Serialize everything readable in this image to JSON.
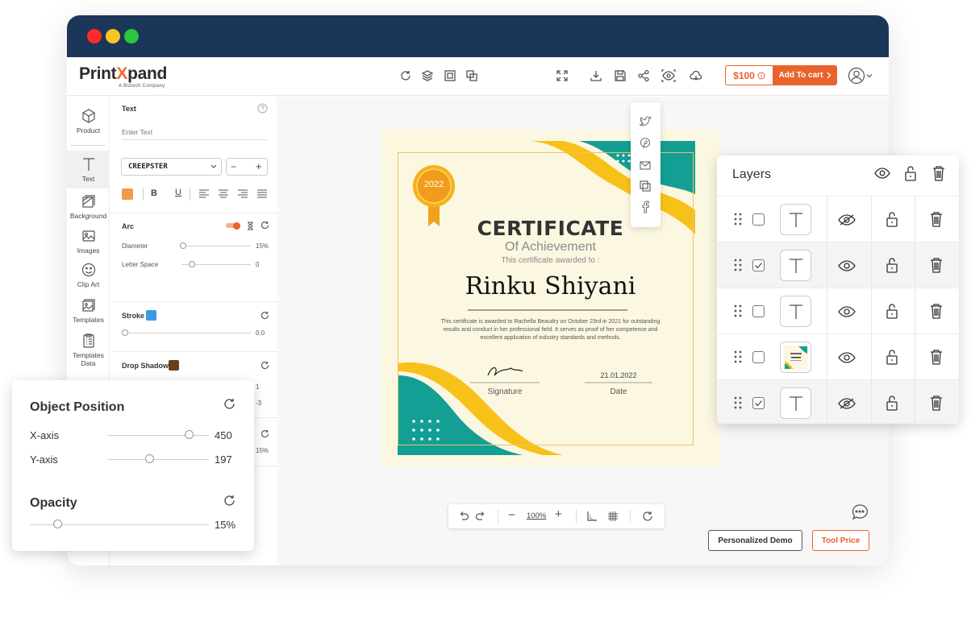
{
  "window": {
    "dots": [
      "#ff2a2a",
      "#f7c325",
      "#2bc63b"
    ]
  },
  "brand": {
    "name_a": "Print",
    "name_x": "X",
    "name_b": "pand",
    "sub": "A Biztech Company",
    "accent": "#e8642c"
  },
  "header": {
    "price": "$100",
    "cart": "Add To cart"
  },
  "rail": [
    {
      "label": "Product",
      "icon": "cube-icon"
    },
    {
      "label": "Text",
      "icon": "text-t-icon"
    },
    {
      "label": "Background",
      "icon": "background-icon"
    },
    {
      "label": "Images",
      "icon": "image-icon"
    },
    {
      "label": "Clip Art",
      "icon": "smiley-icon"
    },
    {
      "label": "Templates",
      "icon": "templates-icon"
    },
    {
      "label": "Templates Data",
      "icon": "templates-data-icon"
    }
  ],
  "text_panel": {
    "title": "Text",
    "placeholder": "Enter Text",
    "font": "CREEPSTER",
    "arc": "Arc",
    "diameter": "Diameter",
    "diameter_value": "15%",
    "letter_space": "Letter Space",
    "letter_space_value": "0",
    "stroke": "Stroke",
    "stroke_value": "0.0",
    "drop_shadow": "Drop Shadow",
    "hidden_a": "1",
    "hidden_b": "-3",
    "hidden_c": "15%",
    "colors": {
      "text": "#f19a4a",
      "stroke": "#3b9be0",
      "shadow": "#6b3f17"
    }
  },
  "certificate": {
    "badge": "2022",
    "title": "CERTIFICATE",
    "subtitle": "Of Achievement",
    "awarded": "This certificate awarded to :",
    "name": "Rinku Shiyani",
    "body_lines": [
      "This certificate is awarded to Rachella Beaudry on October 23rd in 2021 for outstanding",
      "results and conduct in her professional field. It serves as proof of her competence and",
      "excellent application of industry standards and methods."
    ],
    "date": "21.01.2022",
    "signature_label": "Signature",
    "date_label": "Date"
  },
  "zoom": {
    "value": "100%"
  },
  "buttons": {
    "demo": "Personalized Demo",
    "tool_price": "Tool Price"
  },
  "layers": {
    "title": "Layers",
    "rows": [
      {
        "checked": false,
        "visible": false,
        "thumb": "text"
      },
      {
        "checked": true,
        "visible": true,
        "thumb": "text"
      },
      {
        "checked": false,
        "visible": true,
        "thumb": "text"
      },
      {
        "checked": false,
        "visible": true,
        "thumb": "certificate"
      },
      {
        "checked": true,
        "visible": false,
        "thumb": "text"
      }
    ]
  },
  "object_position": {
    "title": "Object Position",
    "x_label": "X-axis",
    "x_value": "450",
    "y_label": "Y-axis",
    "y_value": "197",
    "opacity_label": "Opacity",
    "opacity_value": "15%"
  }
}
